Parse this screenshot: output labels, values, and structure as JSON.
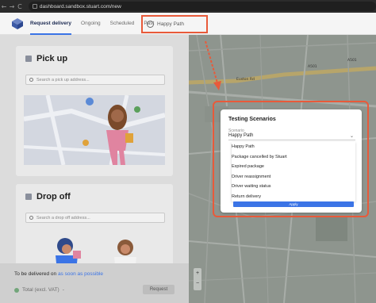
{
  "browser": {
    "url": "dashboard.sandbox.stuart.com/new",
    "back_glyph": "←",
    "forward_glyph": "→",
    "reload_glyph": "C"
  },
  "header": {
    "tabs": [
      {
        "label": "Request delivery",
        "active": true
      },
      {
        "label": "Ongoing",
        "active": false
      },
      {
        "label": "Scheduled",
        "active": false
      },
      {
        "label": "Past",
        "active": false
      }
    ],
    "happy_path_label": "Happy Path",
    "highlight_color": "#e85a3a"
  },
  "pickup": {
    "title": "Pick up",
    "search_placeholder": "Search a pick up address..."
  },
  "dropoff": {
    "title": "Drop off",
    "search_placeholder": "Search a drop off address..."
  },
  "footer": {
    "deliver_prefix": "To be delivered on",
    "deliver_emphasis": "as soon as possible",
    "total_label": "Total (excl. VAT)",
    "total_dash": "-",
    "request_button": "Request"
  },
  "map": {
    "road_labels": [
      "A501",
      "A501",
      "Euston Rd"
    ]
  },
  "scenarios_modal": {
    "title": "Testing Scenarios",
    "field_label": "Scenario",
    "selected": "Happy Path",
    "options": [
      "Happy Path",
      "Package cancelled by Stuart",
      "Expired package",
      "Driver reassignment",
      "Driver waiting status",
      "Return delivery"
    ],
    "apply_label": "Apply",
    "accent": "#3b74e6"
  },
  "zoom": {
    "plus": "+",
    "minus": "−"
  }
}
